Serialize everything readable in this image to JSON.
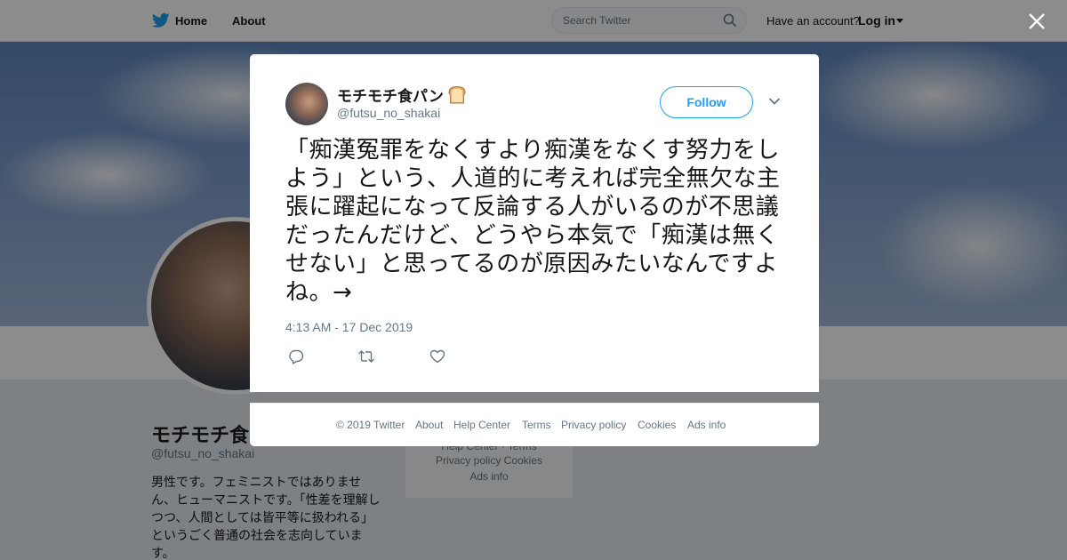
{
  "nav": {
    "home": "Home",
    "about": "About",
    "search_placeholder": "Search Twitter",
    "have_account": "Have an account?",
    "login": "Log in"
  },
  "profile": {
    "name": "モチモチ食",
    "handle": "@futsu_no_shakai",
    "bio": "男性です。フェミニストではありません、ヒューマニストです。「性差を理解しつつ、人間としては皆平等に扱われる」というごく普通の社会を志向しています。"
  },
  "sidebar_links": {
    "row1": "Help Center · Terms",
    "row2": "Privacy policy   Cookies",
    "row3": "Ads info"
  },
  "tweet": {
    "author_name": "モチモチ食パン",
    "author_handle": "@futsu_no_shakai",
    "follow_label": "Follow",
    "text": "「痴漢冤罪をなくすより痴漢をなくす努力をしよう」という、人道的に考えれば完全無欠な主張に躍起になって反論する人がいるのが不思議だったんだけど、どうやら本気で「痴漢は無くせない」と思ってるのが原因みたいなんですよね。→",
    "timestamp": "4:13 AM - 17 Dec 2019"
  },
  "footer": {
    "copyright": "© 2019 Twitter",
    "about": "About",
    "help_center": "Help Center",
    "terms": "Terms",
    "privacy": "Privacy policy",
    "cookies": "Cookies",
    "ads_info": "Ads info"
  },
  "colors": {
    "twitter_blue": "#1da1f2",
    "text_primary": "#14171a",
    "text_secondary": "#657786"
  },
  "icons": [
    "twitter-bird-icon",
    "search-icon",
    "caret-down-icon",
    "close-icon",
    "bread-emoji-icon",
    "chevron-down-icon",
    "reply-icon",
    "retweet-icon",
    "like-icon"
  ]
}
